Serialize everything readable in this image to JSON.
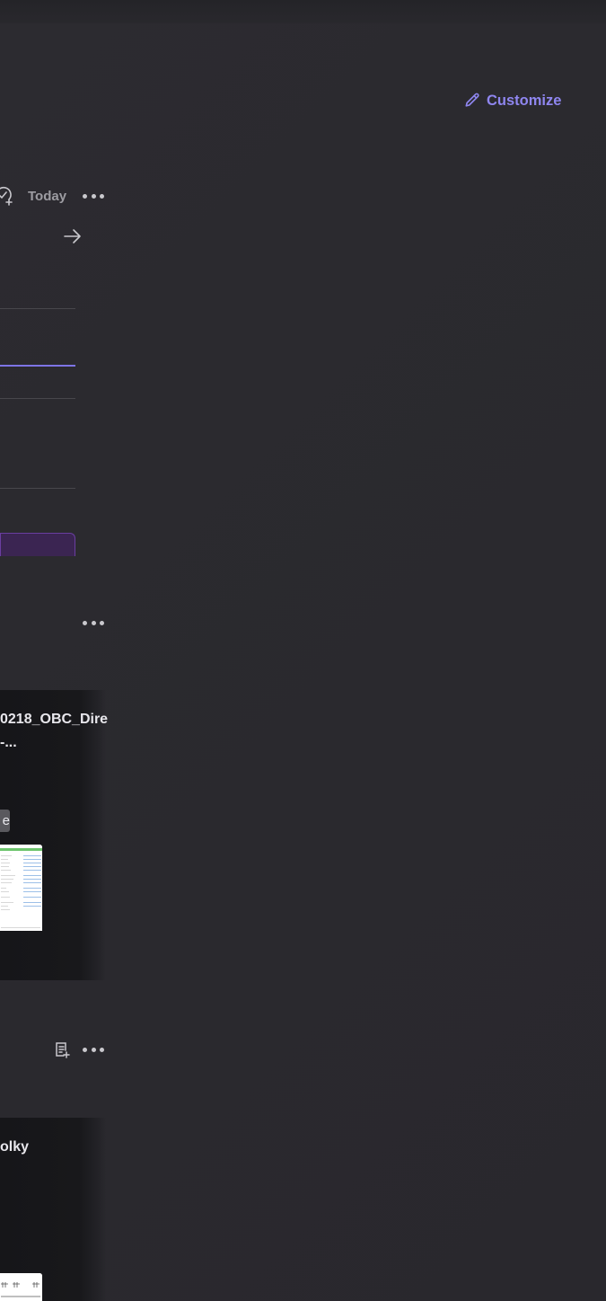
{
  "toolbar": {
    "customize_label": "Customize",
    "customize_icon": "pencil-icon",
    "accent_color": "#8f86f0"
  },
  "tasks_widget": {
    "add_task_icon": "task-add-icon",
    "date_label": "Today",
    "more_icon": "more-horizontal-icon",
    "next_icon": "arrow-right-icon"
  },
  "files_widget": {
    "more_icon": "more-horizontal-icon",
    "card": {
      "title_line1": "0218_OBC_Dire",
      "title_line2": "-...",
      "tag_text": "e"
    }
  },
  "notes_widget": {
    "add_note_icon": "note-add-icon",
    "more_icon": "more-horizontal-icon",
    "card": {
      "title": "olky"
    }
  }
}
